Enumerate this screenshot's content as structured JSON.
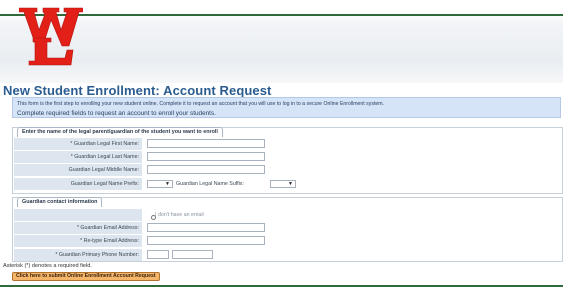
{
  "header": {
    "logo_text": "WL"
  },
  "page": {
    "title": "New Student Enrollment: Account Request"
  },
  "info": {
    "line1": "This form is the first step to enrolling your new student online. Complete it to request an account that you will use to log in to a secure Online Enrollment system.",
    "line2": "Complete required fields to request an account to enroll your students."
  },
  "guardian_section": {
    "tab_label": "Enter the name of the legal parent/guardian of the student you want to enroll",
    "first_name_label": "* Guardian Legal First Name:",
    "first_name_value": "",
    "last_name_label": "* Guardian Legal Last Name:",
    "last_name_value": "",
    "middle_name_label": "Guardian Legal Middle Name:",
    "middle_name_value": "",
    "prefix_label": "Guardian Legal Name Prefix:",
    "prefix_selected": "",
    "suffix_label": "Guardian Legal Name Suffix:",
    "suffix_selected": ""
  },
  "contact_section": {
    "tab_label": "Guardian contact information",
    "no_email_label": "I don't have an email",
    "no_email_checked": false,
    "email_label": "* Guardian Email Address:",
    "email_value": "",
    "retype_email_label": "* Re-type Email Address:",
    "retype_email_value": "",
    "phone_label": "* Guardian Primary Phone Number:",
    "phone_part1": "",
    "phone_part2": ""
  },
  "footer": {
    "required_note": "Asterisk (*) denotes a required field.",
    "submit_label": "Click here to submit Online Enrollment Account Request"
  },
  "colors": {
    "brand_red": "#e32017",
    "title_blue": "#2a5c90",
    "info_bg": "#d6e4f7",
    "label_bg": "#dde5ee",
    "submit_bg": "#f6b66a",
    "rule_green": "#2f6b3a"
  }
}
